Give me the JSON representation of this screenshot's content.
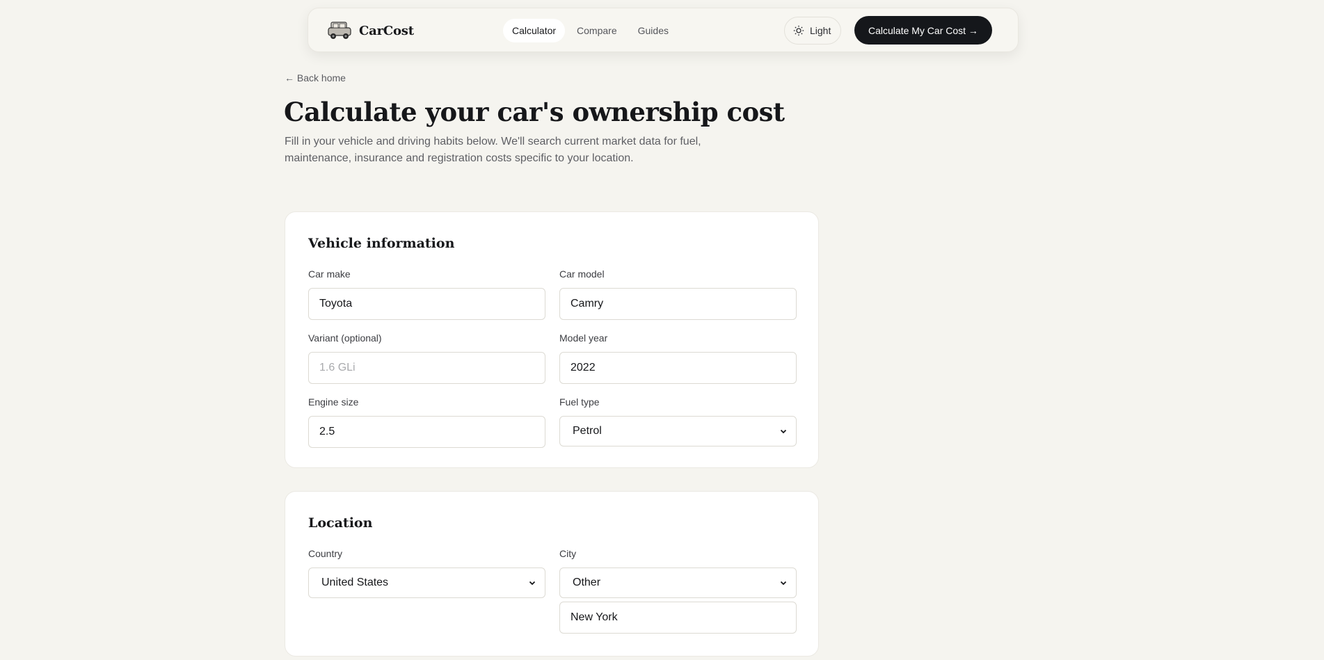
{
  "nav": {
    "brand": "CarCost",
    "links": [
      {
        "label": "Calculator",
        "active": true
      },
      {
        "label": "Compare",
        "active": false
      },
      {
        "label": "Guides",
        "active": false
      }
    ],
    "theme_label": "Light",
    "theme_icon": "sun-icon",
    "cta_label": "Calculate My Car Cost →"
  },
  "header": {
    "back_label": "← Back home",
    "title": "Calculate your car's ownership cost",
    "subtitle": "Fill in your vehicle and driving habits below. We'll search current market data for fuel, maintenance, insurance and registration costs specific to your location."
  },
  "vehicle": {
    "title": "Vehicle information",
    "make": {
      "label": "Car make",
      "value": "Toyota"
    },
    "model": {
      "label": "Car model",
      "value": "Camry"
    },
    "variant": {
      "label": "Variant (optional)",
      "value": "",
      "placeholder": "1.6 GLi"
    },
    "year": {
      "label": "Model year",
      "value": "2022"
    },
    "engine": {
      "label": "Engine size",
      "value": "2.5"
    },
    "fuel": {
      "label": "Fuel type",
      "value": "Petrol"
    }
  },
  "location": {
    "title": "Location",
    "country": {
      "label": "Country",
      "value": "United States"
    },
    "city": {
      "label": "City",
      "value": "Other"
    },
    "city_custom": {
      "value": "New York"
    }
  },
  "colors": {
    "background": "#f5f4ef",
    "cta": "#15171b",
    "card": "#ffffff"
  }
}
